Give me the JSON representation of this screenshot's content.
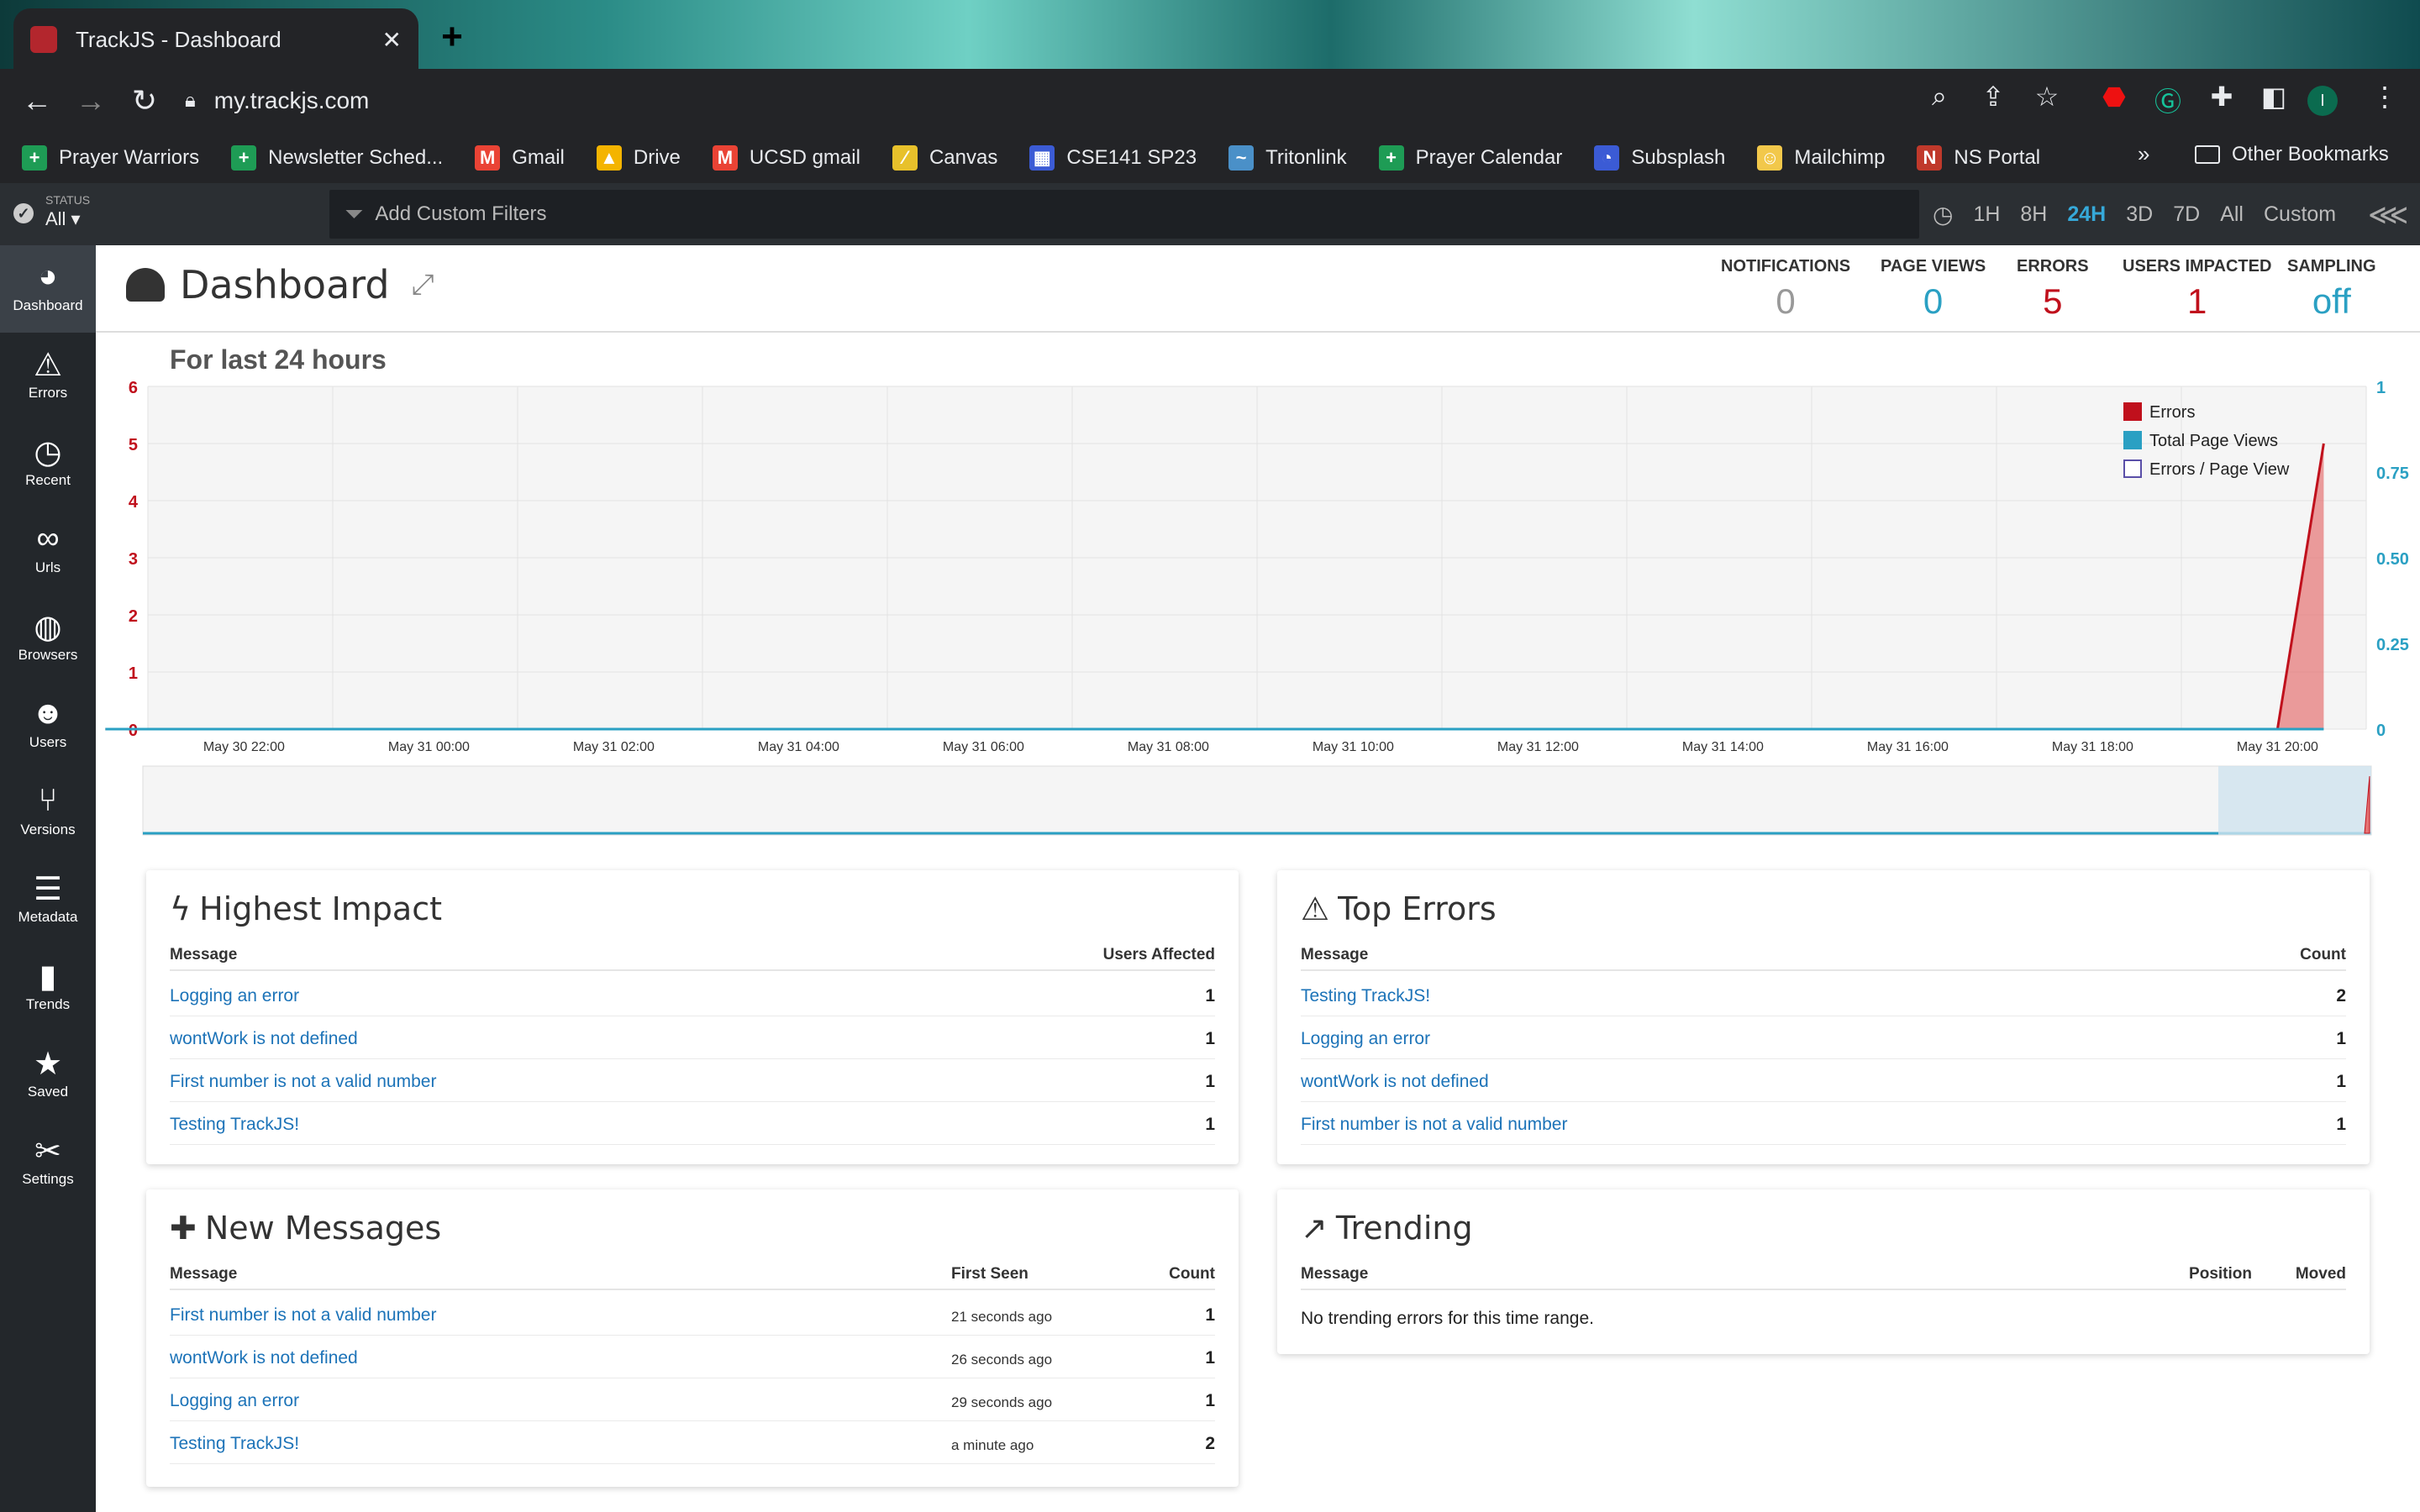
{
  "browser": {
    "tab_title": "TrackJS - Dashboard",
    "tab_close": "✕",
    "new_tab": "+",
    "url": "my.trackjs.com",
    "bookmarks": [
      {
        "label": "Prayer Warriors",
        "color": "#1e9c55",
        "glyph": "+"
      },
      {
        "label": "Newsletter Sched...",
        "color": "#1e9c55",
        "glyph": "+"
      },
      {
        "label": "Gmail",
        "color": "#ea4335",
        "glyph": "M"
      },
      {
        "label": "Drive",
        "color": "#f4b400",
        "glyph": "▲"
      },
      {
        "label": "UCSD gmail",
        "color": "#ea4335",
        "glyph": "M"
      },
      {
        "label": "Canvas",
        "color": "#e8c12b",
        "glyph": "⁄"
      },
      {
        "label": "CSE141 SP23",
        "color": "#3b5bd5",
        "glyph": "▦"
      },
      {
        "label": "Tritonlink",
        "color": "#4a90c8",
        "glyph": "~"
      },
      {
        "label": "Prayer Calendar",
        "color": "#1e9c55",
        "glyph": "+"
      },
      {
        "label": "Subsplash",
        "color": "#3b5bd5",
        "glyph": "◔"
      },
      {
        "label": "Mailchimp",
        "color": "#f2c84b",
        "glyph": "☺"
      },
      {
        "label": "NS Portal",
        "color": "#c0392b",
        "glyph": "N"
      }
    ],
    "bookmarks_overflow": "»",
    "other_bookmarks": "Other Bookmarks",
    "profile_initial": "I"
  },
  "filterbar": {
    "status_label": "STATUS",
    "status_value": "All ▾",
    "filter_placeholder": "Add Custom Filters",
    "time_ranges": [
      "1H",
      "8H",
      "24H",
      "3D",
      "7D",
      "All",
      "Custom"
    ],
    "active_range": "24H"
  },
  "sidebar": {
    "items": [
      {
        "label": "Dashboard",
        "icon": "dashboard-icon",
        "glyph": "◕"
      },
      {
        "label": "Errors",
        "icon": "warning-icon",
        "glyph": "⚠"
      },
      {
        "label": "Recent",
        "icon": "clock-icon",
        "glyph": "◷"
      },
      {
        "label": "Urls",
        "icon": "link-icon",
        "glyph": "∞"
      },
      {
        "label": "Browsers",
        "icon": "www-icon",
        "glyph": "◍"
      },
      {
        "label": "Users",
        "icon": "users-icon",
        "glyph": "☻"
      },
      {
        "label": "Versions",
        "icon": "branch-icon",
        "glyph": "⑂"
      },
      {
        "label": "Metadata",
        "icon": "database-icon",
        "glyph": "☰"
      },
      {
        "label": "Trends",
        "icon": "bar-chart-icon",
        "glyph": "▮"
      },
      {
        "label": "Saved",
        "icon": "star-icon",
        "glyph": "★"
      },
      {
        "label": "Settings",
        "icon": "tools-icon",
        "glyph": "✂"
      }
    ]
  },
  "header": {
    "title": "Dashboard",
    "stats": [
      {
        "label": "NOTIFICATIONS",
        "value": "0",
        "color": "#999999"
      },
      {
        "label": "PAGE VIEWS",
        "value": "0",
        "color": "#2aa0c3"
      },
      {
        "label": "ERRORS",
        "value": "5",
        "color": "#c0101c"
      },
      {
        "label": "USERS IMPACTED",
        "value": "1",
        "color": "#c0101c"
      },
      {
        "label": "SAMPLING",
        "value": "off",
        "color": "#2aa0c3"
      }
    ]
  },
  "subtitle": "For last 24 hours",
  "chart_data": {
    "type": "area",
    "x_tick_labels": [
      "May 30 22:00",
      "May 31 00:00",
      "May 31 02:00",
      "May 31 04:00",
      "May 31 06:00",
      "May 31 08:00",
      "May 31 10:00",
      "May 31 12:00",
      "May 31 14:00",
      "May 31 16:00",
      "May 31 18:00",
      "May 31 20:00"
    ],
    "y_left_ticks": [
      "0",
      "1",
      "2",
      "3",
      "4",
      "5",
      "6"
    ],
    "y_right_ticks": [
      "0",
      "0.25",
      "0.50",
      "0.75",
      "1"
    ],
    "y_left_range": [
      0,
      6
    ],
    "y_right_range": [
      0,
      1
    ],
    "series": [
      {
        "name": "Errors",
        "color": "#c0101c",
        "points": [
          [
            "May 30 20:30",
            0
          ],
          [
            "May 31 20:00",
            0
          ],
          [
            "May 31 20:30",
            5
          ]
        ]
      },
      {
        "name": "Total Page Views",
        "color": "#2aa0c3",
        "points": [
          [
            "May 30 20:30",
            0
          ],
          [
            "May 31 20:30",
            0
          ]
        ]
      },
      {
        "name": "Errors / Page View",
        "color": "#5a4fa8",
        "points": []
      }
    ],
    "legend_position": "top-right",
    "grid": true
  },
  "highest_impact": {
    "title": "Highest Impact",
    "col_message": "Message",
    "col_count": "Users Affected",
    "rows": [
      {
        "message": "Logging an error",
        "count": "1"
      },
      {
        "message": "wontWork is not defined",
        "count": "1"
      },
      {
        "message": "First number is not a valid number",
        "count": "1"
      },
      {
        "message": "Testing TrackJS!",
        "count": "1"
      }
    ]
  },
  "top_errors": {
    "title": "Top Errors",
    "col_message": "Message",
    "col_count": "Count",
    "rows": [
      {
        "message": "Testing TrackJS!",
        "count": "2"
      },
      {
        "message": "Logging an error",
        "count": "1"
      },
      {
        "message": "wontWork is not defined",
        "count": "1"
      },
      {
        "message": "First number is not a valid number",
        "count": "1"
      }
    ]
  },
  "new_messages": {
    "title": "New Messages",
    "col_message": "Message",
    "col_first_seen": "First Seen",
    "col_count": "Count",
    "rows": [
      {
        "message": "First number is not a valid number",
        "first_seen": "21 seconds ago",
        "count": "1"
      },
      {
        "message": "wontWork is not defined",
        "first_seen": "26 seconds ago",
        "count": "1"
      },
      {
        "message": "Logging an error",
        "first_seen": "29 seconds ago",
        "count": "1"
      },
      {
        "message": "Testing TrackJS!",
        "first_seen": "a minute ago",
        "count": "2"
      }
    ]
  },
  "trending": {
    "title": "Trending",
    "col_message": "Message",
    "col_position": "Position",
    "col_moved": "Moved",
    "empty_text": "No trending errors for this time range."
  }
}
